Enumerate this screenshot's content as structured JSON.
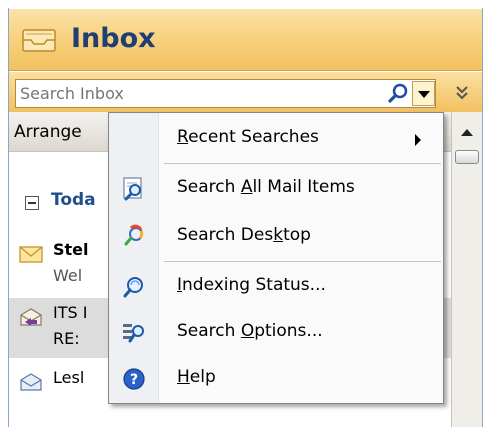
{
  "header": {
    "title": "Inbox"
  },
  "search": {
    "placeholder": "Search Inbox"
  },
  "arrange": {
    "label": "Arrange"
  },
  "group": {
    "label": "Toda"
  },
  "mails": [
    {
      "sender": "Stel",
      "subject": "Wel",
      "unread": true
    },
    {
      "sender": "ITS I",
      "subject": "RE:",
      "unread": false
    },
    {
      "sender": "Lesl",
      "subject": "",
      "unread": false
    }
  ],
  "menu": {
    "items": [
      {
        "pre": "",
        "key": "R",
        "post": "ecent Searches",
        "icon": "none",
        "has_submenu": true
      },
      {
        "pre": "Search ",
        "key": "A",
        "post": "ll Mail Items",
        "icon": "search-all-mail-icon"
      },
      {
        "pre": "Search Des",
        "key": "k",
        "post": "top",
        "icon": "search-desktop-icon"
      },
      {
        "pre": "",
        "key": "I",
        "post": "ndexing Status...",
        "icon": "indexing-status-icon"
      },
      {
        "pre": "Search ",
        "key": "O",
        "post": "ptions...",
        "icon": "search-options-icon"
      },
      {
        "pre": "",
        "key": "H",
        "post": "elp",
        "icon": "help-icon"
      }
    ]
  },
  "colors": {
    "header_gradient_top": "#fbe2a8",
    "header_gradient_bottom": "#f3c160",
    "title_color": "#1f3f72",
    "group_color": "#1f4f8a"
  }
}
